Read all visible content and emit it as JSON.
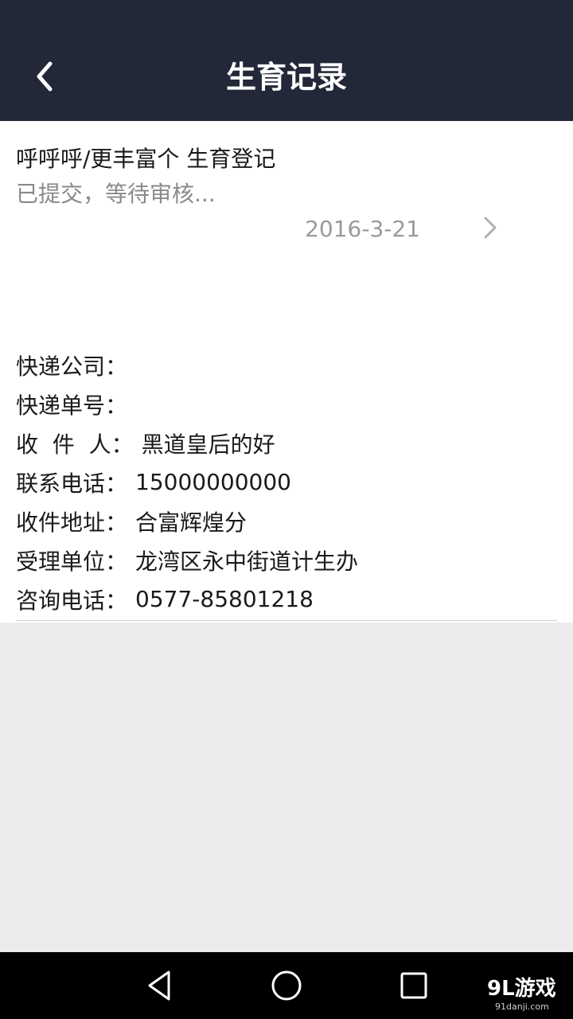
{
  "header": {
    "title": "生育记录",
    "back_icon": "chevron-left-icon"
  },
  "record": {
    "title": "呼呼呼/更丰富个 生育登记",
    "status": "已提交，等待审核...",
    "date": "2016-3-21",
    "chevron_icon": "chevron-right-icon"
  },
  "details": [
    {
      "label": "快递公司：",
      "value": ""
    },
    {
      "label": "快递单号：",
      "value": ""
    },
    {
      "label": "收  件  人：",
      "value": "黑道皇后的好"
    },
    {
      "label": "联系电话：",
      "value": "15000000000"
    },
    {
      "label": "收件地址：",
      "value": "合富辉煌分"
    },
    {
      "label": "受理单位：",
      "value": "龙湾区永中街道计生办"
    },
    {
      "label": "咨询电话：",
      "value": "0577-85801218"
    }
  ],
  "navbar": {
    "back_icon": "triangle-back-icon",
    "home_icon": "circle-home-icon",
    "recents_icon": "square-recents-icon"
  },
  "watermark": {
    "text": "9L游戏",
    "sub": "91danji.com"
  },
  "colors": {
    "header_bg": "#232838",
    "page_bg": "#ececec",
    "card_bg": "#ffffff",
    "muted_text": "#8a8a8a"
  }
}
